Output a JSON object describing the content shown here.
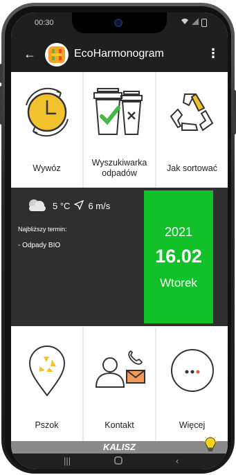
{
  "status_bar": {
    "time": "00:30"
  },
  "app_bar": {
    "title": "EcoHarmonogram"
  },
  "tiles_top": [
    {
      "label": "Wywóz"
    },
    {
      "label": "Wyszukiwarka odpadów"
    },
    {
      "label": "Jak sortować"
    }
  ],
  "weather": {
    "temperature": "5 °C",
    "wind": "6 m/s"
  },
  "next_collection": {
    "title": "Najbliższy termin:",
    "items": [
      "- Odpady BIO"
    ]
  },
  "date": {
    "year": "2021",
    "day": "16.02",
    "weekday": "Wtorek"
  },
  "tiles_bottom": [
    {
      "label": "Pszok"
    },
    {
      "label": "Kontakt"
    },
    {
      "label": "Więcej"
    }
  ],
  "city": "KALISZ",
  "colors": {
    "accent_green": "#12c12a",
    "dark_panel": "#2f2f2f",
    "app_bar": "#1f1f1f",
    "yellow": "#f2c12e"
  }
}
